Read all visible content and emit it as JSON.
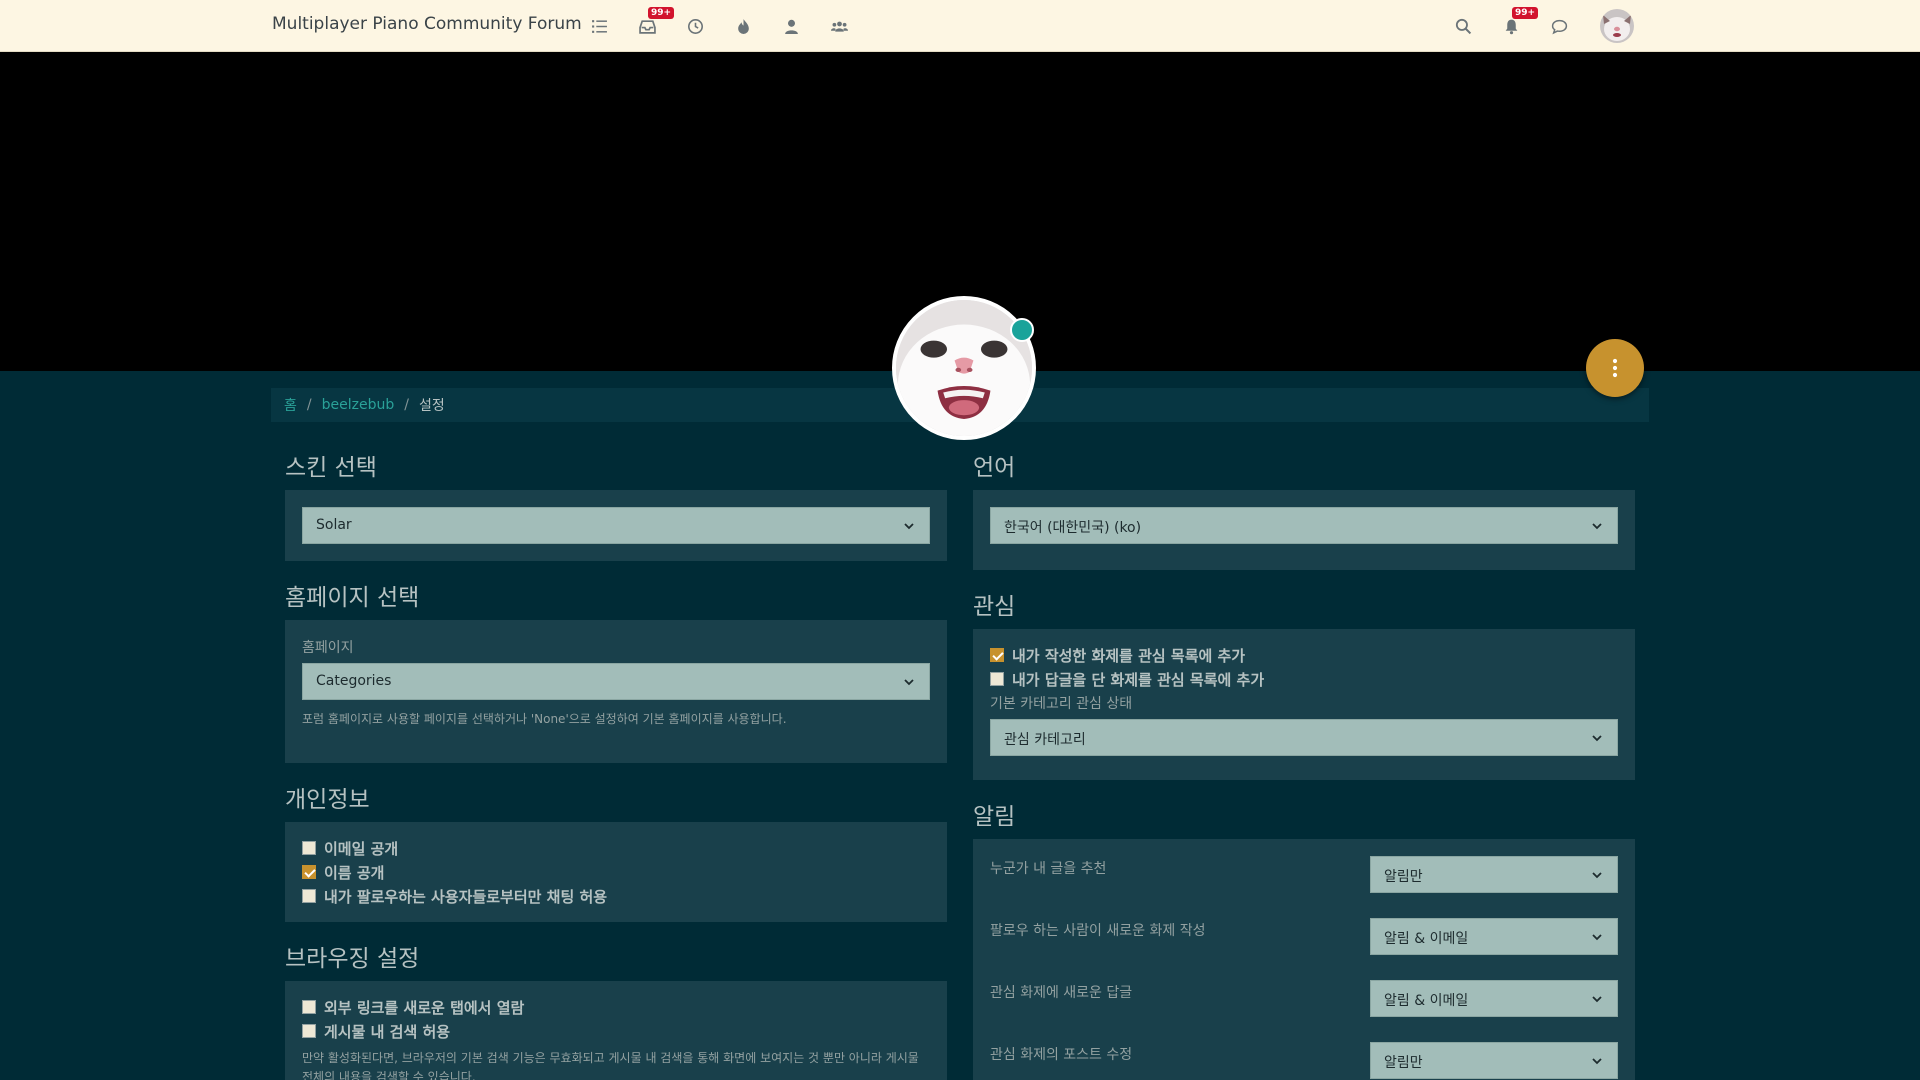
{
  "header": {
    "brand": "Multiplayer Piano Community Forum",
    "nav": [
      {
        "name": "categories-icon",
        "badge": ""
      },
      {
        "name": "unread-icon",
        "badge": "99+"
      },
      {
        "name": "recent-icon",
        "badge": ""
      },
      {
        "name": "popular-icon",
        "badge": ""
      },
      {
        "name": "users-icon",
        "badge": ""
      },
      {
        "name": "groups-icon",
        "badge": ""
      }
    ],
    "right": [
      {
        "name": "search-icon",
        "badge": ""
      },
      {
        "name": "notifications-icon",
        "badge": "99+"
      },
      {
        "name": "chat-icon",
        "badge": ""
      }
    ]
  },
  "breadcrumb": {
    "home": "홈",
    "user": "beelzebub",
    "current": "설정"
  },
  "skin": {
    "title": "스킨 선택",
    "value": "Solar"
  },
  "homepage": {
    "title": "홈페이지 선택",
    "label": "홈페이지",
    "value": "Categories",
    "help": "포럼 홈페이지로 사용할 페이지를 선택하거나 'None'으로 설정하여 기본 홈페이지를 사용합니다."
  },
  "privacy": {
    "title": "개인정보",
    "items": [
      {
        "label": "이메일 공개",
        "checked": false
      },
      {
        "label": "이름 공개",
        "checked": true
      },
      {
        "label": "내가 팔로우하는 사용자들로부터만 채팅 허용",
        "checked": false
      }
    ]
  },
  "browsing": {
    "title": "브라우징 설정",
    "items": [
      {
        "label": "외부 링크를 새로운 탭에서 열람",
        "checked": false
      },
      {
        "label": "게시물 내 검색 허용",
        "checked": false
      }
    ],
    "help": "만약 활성화된다면, 브라우저의 기본 검색 기능은 무효화되고 게시물 내 검색을 통해 화면에 보여지는 것 뿐만 아니라 게시물 전체의 내용을 검색할 수 있습니다."
  },
  "language": {
    "title": "언어",
    "value": "한국어 (대한민국) (ko)"
  },
  "watch": {
    "title": "관심",
    "items": [
      {
        "label": "내가 작성한 화제를 관심 목록에 추가",
        "checked": true
      },
      {
        "label": "내가 답글을 단 화제를 관심 목록에 추가",
        "checked": false
      }
    ],
    "category_label": "기본 카테고리 관심 상태",
    "category_value": "관심 카테고리"
  },
  "notifications": {
    "title": "알림",
    "rows": [
      {
        "label": "누군가 내 글을 추천",
        "value": "알림만"
      },
      {
        "label": "팔로우 하는 사람이 새로운 화제 작성",
        "value": "알림 & 이메일"
      },
      {
        "label": "관심 화제에 새로운 답글",
        "value": "알림 & 이메일"
      },
      {
        "label": "관심 화제의 포스트 수정",
        "value": "알림만"
      }
    ]
  },
  "colors": {
    "accent": "#c7922e",
    "link": "#2aa198",
    "online": "#1aa39a",
    "background": "#002b36",
    "panel": "#19404b"
  }
}
